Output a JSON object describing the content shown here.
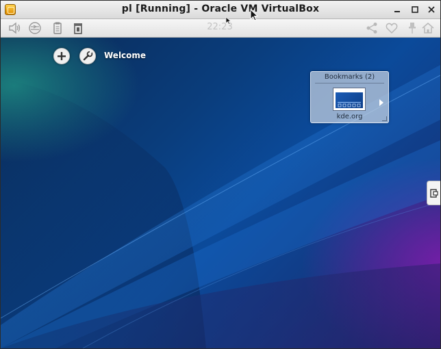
{
  "window": {
    "title": "pl [Running] - Oracle VM VirtualBox",
    "app_icon": "virtualbox-icon",
    "controls": {
      "minimize": "✕",
      "close": "✕"
    }
  },
  "toolbar": {
    "clock": "22:23",
    "left_icons": [
      "speaker-icon",
      "network-icon",
      "clipboard-icon",
      "trash-icon"
    ],
    "right_icons": [
      "share-icon",
      "heart-icon",
      "pin-icon",
      "home-icon"
    ]
  },
  "desktop": {
    "activity_label": "Welcome",
    "add_widget_icon": "plus-icon",
    "configure_icon": "wrench-icon"
  },
  "bookmarks_widget": {
    "title": "Bookmarks (2)",
    "items": [
      {
        "label": "kde.org"
      }
    ],
    "next_icon": "arrow-right-icon"
  },
  "side_toolbox": {
    "icon": "panel-toggle-icon"
  },
  "colors": {
    "desktop_blue": "#0b4a9a",
    "desktop_purple": "#7a1fb0",
    "titlebar": "#e6e6e6"
  }
}
